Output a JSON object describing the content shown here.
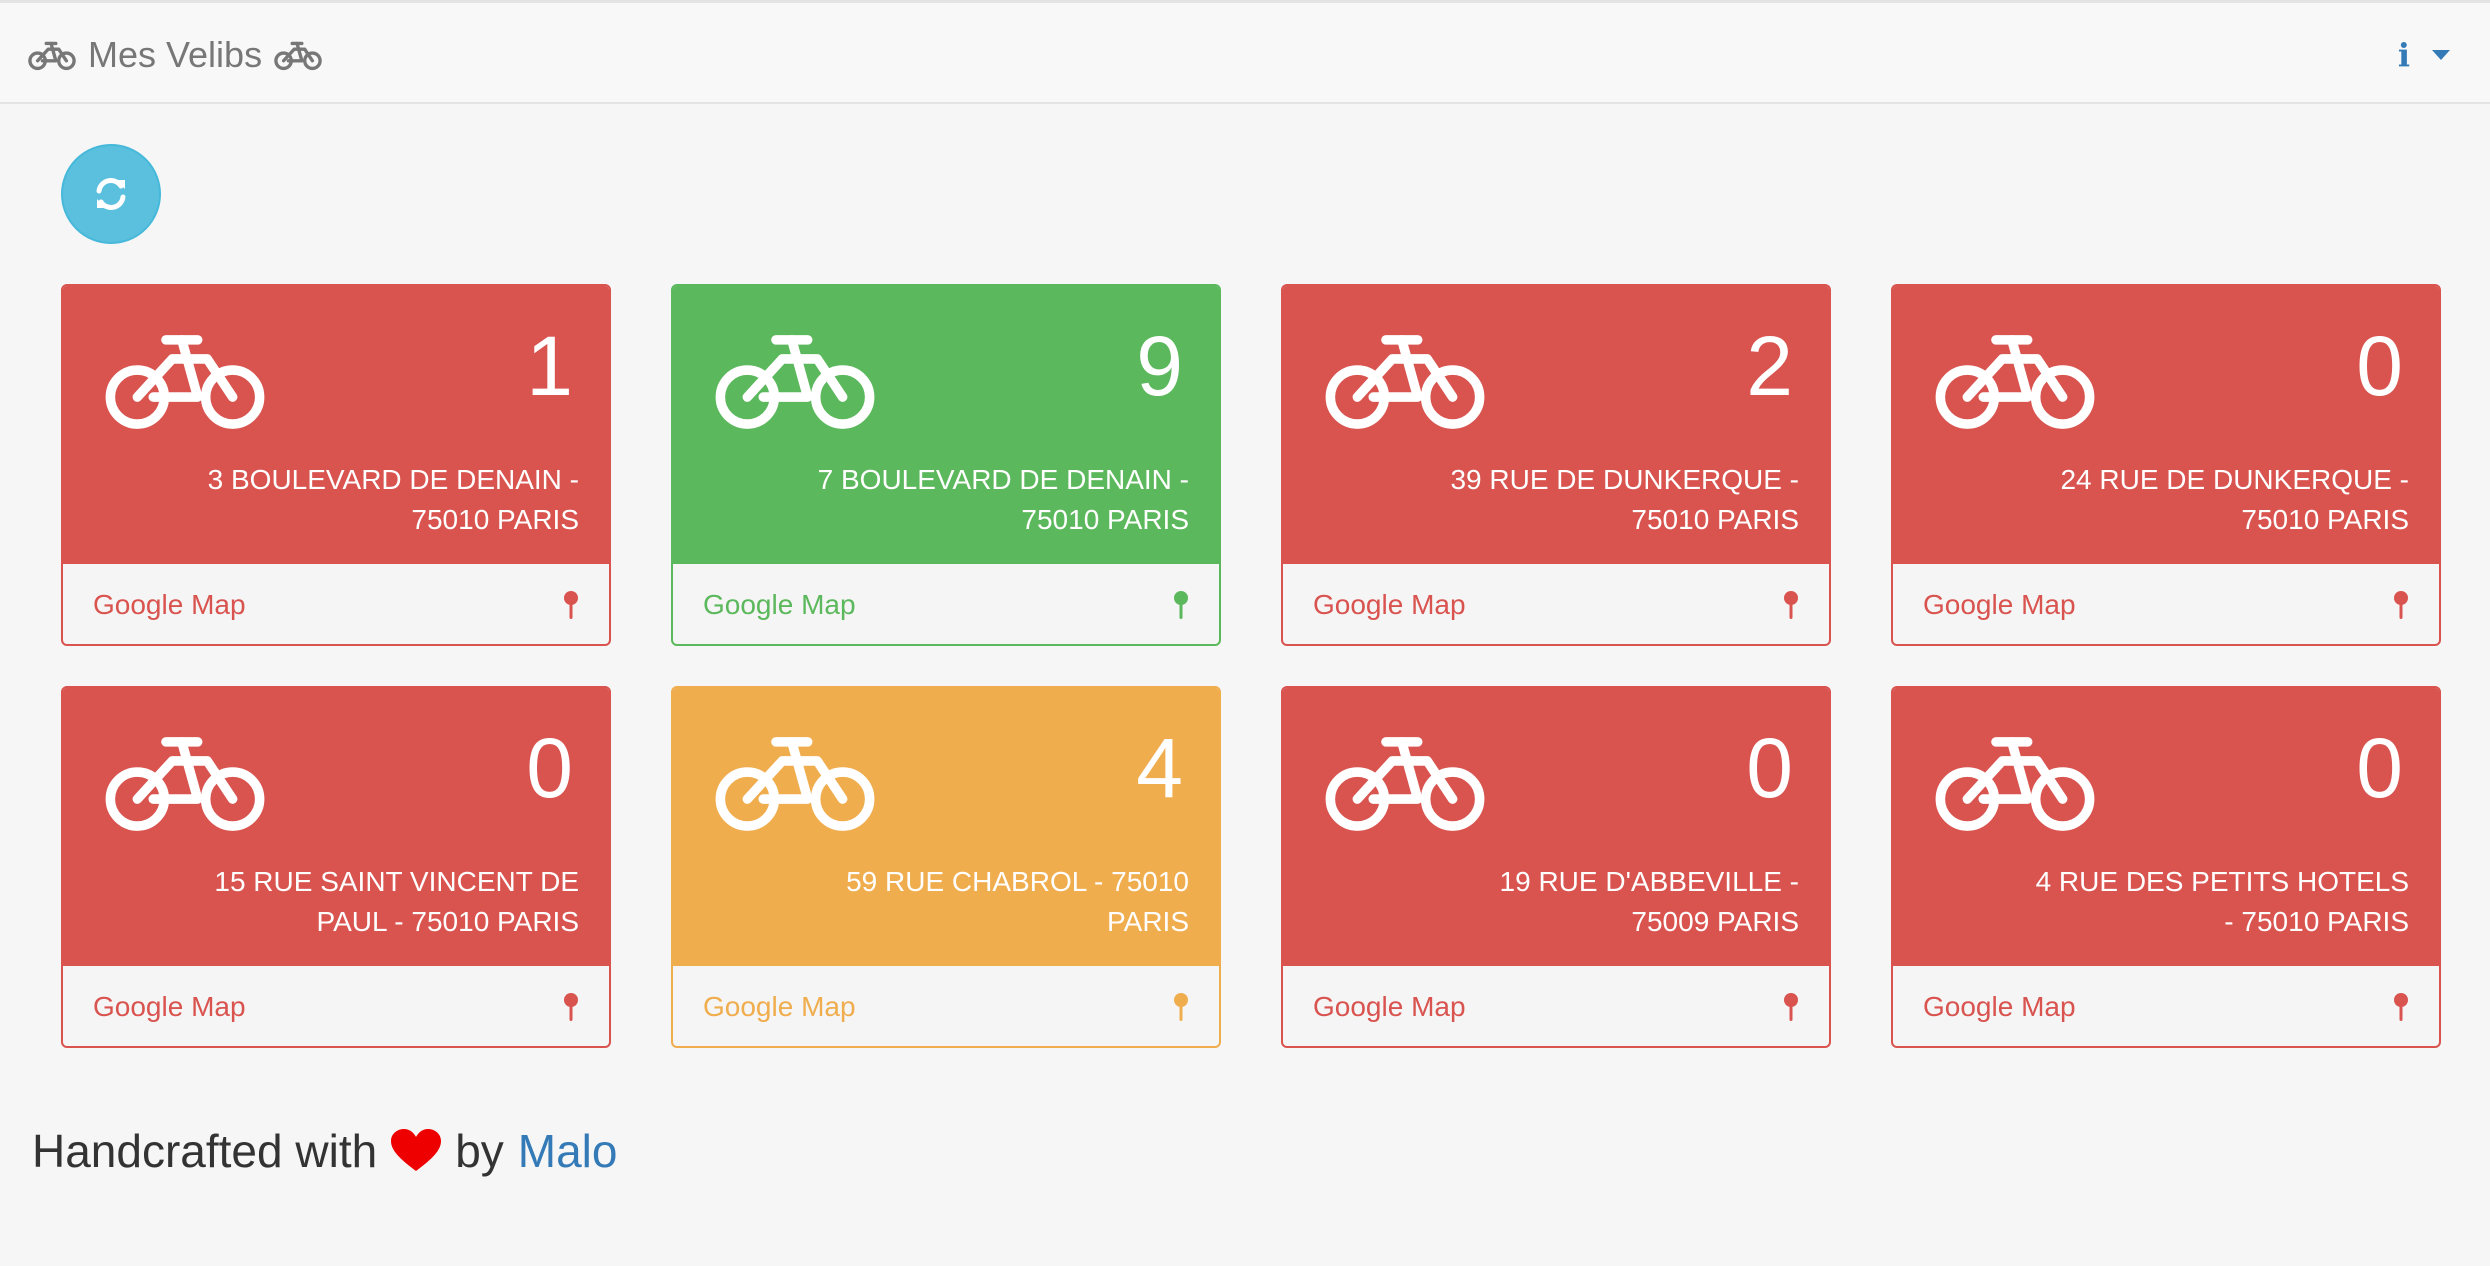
{
  "navbar": {
    "title": "Mes Velibs",
    "info_icon": "info-icon",
    "info_glyph": "i"
  },
  "refresh": {
    "icon": "refresh-icon"
  },
  "colors": {
    "danger": "#d9534f",
    "success": "#5cb85c",
    "warning": "#f0ad4e",
    "info": "#5bc0de",
    "link": "#337ab7"
  },
  "stations": [
    {
      "count": "1",
      "address": "3 BOULEVARD DE DENAIN - 75010 PARIS",
      "link_label": "Google Map",
      "status": "danger"
    },
    {
      "count": "9",
      "address": "7 BOULEVARD DE DENAIN - 75010 PARIS",
      "link_label": "Google Map",
      "status": "success"
    },
    {
      "count": "2",
      "address": "39 RUE DE DUNKERQUE - 75010 PARIS",
      "link_label": "Google Map",
      "status": "danger"
    },
    {
      "count": "0",
      "address": "24 RUE DE DUNKERQUE - 75010 PARIS",
      "link_label": "Google Map",
      "status": "danger"
    },
    {
      "count": "0",
      "address": "15 RUE SAINT VINCENT DE PAUL - 75010 PARIS",
      "link_label": "Google Map",
      "status": "danger"
    },
    {
      "count": "4",
      "address": "59 RUE CHABROL - 75010 PARIS",
      "link_label": "Google Map",
      "status": "warning"
    },
    {
      "count": "0",
      "address": "19 RUE D'ABBEVILLE - 75009 PARIS",
      "link_label": "Google Map",
      "status": "danger"
    },
    {
      "count": "0",
      "address": "4 RUE DES PETITS HOTELS - 75010 PARIS",
      "link_label": "Google Map",
      "status": "danger"
    }
  ],
  "footer": {
    "prefix": "Handcrafted with",
    "middle": "by",
    "author": "Malo",
    "heart_color": "#ee0000"
  }
}
